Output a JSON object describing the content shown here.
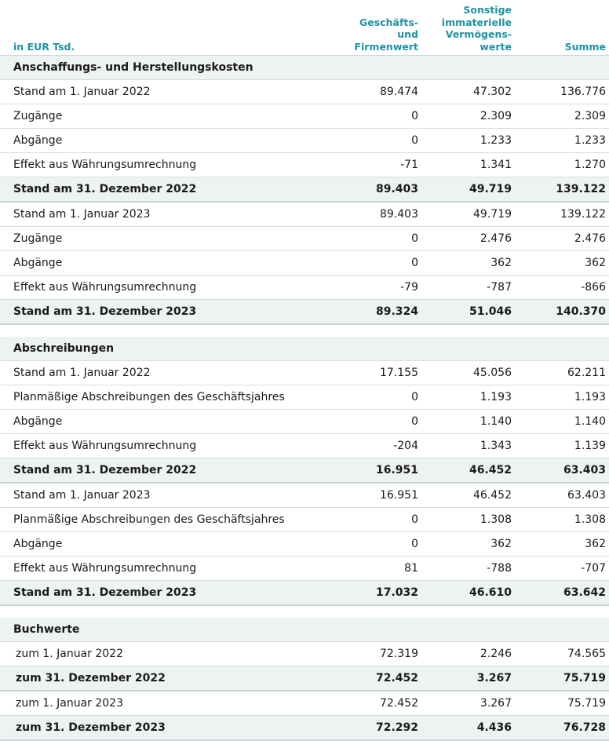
{
  "header": {
    "unit": "in EUR Tsd.",
    "col1": "Geschäfts-\nund\nFirmenwert",
    "col2": "Sonstige\nimmaterielle\nVermögens-\nwerte",
    "col3": "Summe"
  },
  "rows": [
    {
      "kind": "section",
      "label": "Anschaffungs- und Herstellungskosten",
      "v1": "",
      "v2": "",
      "v3": ""
    },
    {
      "kind": "normal",
      "label": "Stand am 1. Januar 2022",
      "v1": "89.474",
      "v2": "47.302",
      "v3": "136.776"
    },
    {
      "kind": "normal",
      "label": "Zugänge",
      "v1": "0",
      "v2": "2.309",
      "v3": "2.309"
    },
    {
      "kind": "normal",
      "label": "Abgänge",
      "v1": "0",
      "v2": "1.233",
      "v3": "1.233"
    },
    {
      "kind": "normal",
      "label": "Effekt aus Währungsumrechnung",
      "v1": "-71",
      "v2": "1.341",
      "v3": "1.270"
    },
    {
      "kind": "total",
      "label": "Stand am 31. Dezember 2022",
      "v1": "89.403",
      "v2": "49.719",
      "v3": "139.122"
    },
    {
      "kind": "normal",
      "label": "Stand am 1. Januar 2023",
      "v1": "89.403",
      "v2": "49.719",
      "v3": "139.122"
    },
    {
      "kind": "normal",
      "label": "Zugänge",
      "v1": "0",
      "v2": "2.476",
      "v3": "2.476"
    },
    {
      "kind": "normal",
      "label": "Abgänge",
      "v1": "0",
      "v2": "362",
      "v3": "362"
    },
    {
      "kind": "normal",
      "label": "Effekt aus Währungsumrechnung",
      "v1": "-79",
      "v2": "-787",
      "v3": "-866"
    },
    {
      "kind": "total",
      "label": "Stand am 31. Dezember 2023",
      "v1": "89.324",
      "v2": "51.046",
      "v3": "140.370"
    },
    {
      "kind": "spacer",
      "label": "",
      "v1": "",
      "v2": "",
      "v3": ""
    },
    {
      "kind": "section",
      "label": "Abschreibungen",
      "v1": "",
      "v2": "",
      "v3": ""
    },
    {
      "kind": "normal",
      "label": "Stand am 1. Januar 2022",
      "v1": "17.155",
      "v2": "45.056",
      "v3": "62.211"
    },
    {
      "kind": "normal",
      "label": "Planmäßige Abschreibungen des Geschäftsjahres",
      "v1": "0",
      "v2": "1.193",
      "v3": "1.193"
    },
    {
      "kind": "normal",
      "label": "Abgänge",
      "v1": "0",
      "v2": "1.140",
      "v3": "1.140"
    },
    {
      "kind": "normal",
      "label": "Effekt aus Währungsumrechnung",
      "v1": "-204",
      "v2": "1.343",
      "v3": "1.139"
    },
    {
      "kind": "total",
      "label": "Stand am 31. Dezember 2022",
      "v1": "16.951",
      "v2": "46.452",
      "v3": "63.403"
    },
    {
      "kind": "normal",
      "label": "Stand am 1. Januar 2023",
      "v1": "16.951",
      "v2": "46.452",
      "v3": "63.403"
    },
    {
      "kind": "normal",
      "label": "Planmäßige Abschreibungen des Geschäftsjahres",
      "v1": "0",
      "v2": "1.308",
      "v3": "1.308"
    },
    {
      "kind": "normal",
      "label": "Abgänge",
      "v1": "0",
      "v2": "362",
      "v3": "362"
    },
    {
      "kind": "normal",
      "label": "Effekt aus Währungsumrechnung",
      "v1": "81",
      "v2": "-788",
      "v3": "-707"
    },
    {
      "kind": "total",
      "label": "Stand am 31. Dezember 2023",
      "v1": "17.032",
      "v2": "46.610",
      "v3": "63.642"
    },
    {
      "kind": "spacer",
      "label": "",
      "v1": "",
      "v2": "",
      "v3": ""
    },
    {
      "kind": "section",
      "label": "Buchwerte",
      "v1": "",
      "v2": "",
      "v3": ""
    },
    {
      "kind": "normal indent",
      "label": "zum 1. Januar 2022",
      "v1": "72.319",
      "v2": "2.246",
      "v3": "74.565"
    },
    {
      "kind": "total indent",
      "label": "zum 31. Dezember 2022",
      "v1": "72.452",
      "v2": "3.267",
      "v3": "75.719"
    },
    {
      "kind": "normal indent",
      "label": "zum 1. Januar 2023",
      "v1": "72.452",
      "v2": "3.267",
      "v3": "75.719"
    },
    {
      "kind": "total indent",
      "label": "zum 31. Dezember 2023",
      "v1": "72.292",
      "v2": "4.436",
      "v3": "76.728"
    }
  ]
}
